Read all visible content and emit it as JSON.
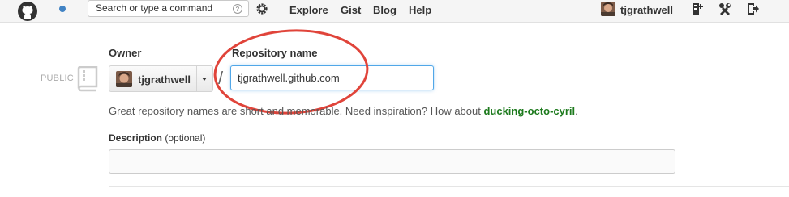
{
  "header": {
    "search_placeholder": "Search or type a command",
    "nav": [
      "Explore",
      "Gist",
      "Blog",
      "Help"
    ],
    "username": "tjgrathwell"
  },
  "form": {
    "owner_label": "Owner",
    "owner_value": "tjgrathwell",
    "visibility_label": "PUBLIC",
    "separator": "/",
    "repo_label": "Repository name",
    "repo_value": "tjgrathwell.github.com",
    "hint_prefix": "Great repository names are short and memorable. Need inspiration? How about ",
    "hint_suggestion": "ducking-octo-cyril",
    "hint_suffix": ".",
    "description_label": "Description",
    "description_optional": "(optional)",
    "description_value": ""
  },
  "colors": {
    "accent": "#4183c4",
    "focus": "#51a7e8",
    "suggestion": "#1d7a1d",
    "annotation": "#e0443a"
  },
  "icons": [
    "github-logo-icon",
    "notification-icon",
    "help-icon",
    "gear-icon",
    "new-repo-icon",
    "settings-icon",
    "sign-out-icon",
    "book-icon",
    "caret-down-icon"
  ]
}
